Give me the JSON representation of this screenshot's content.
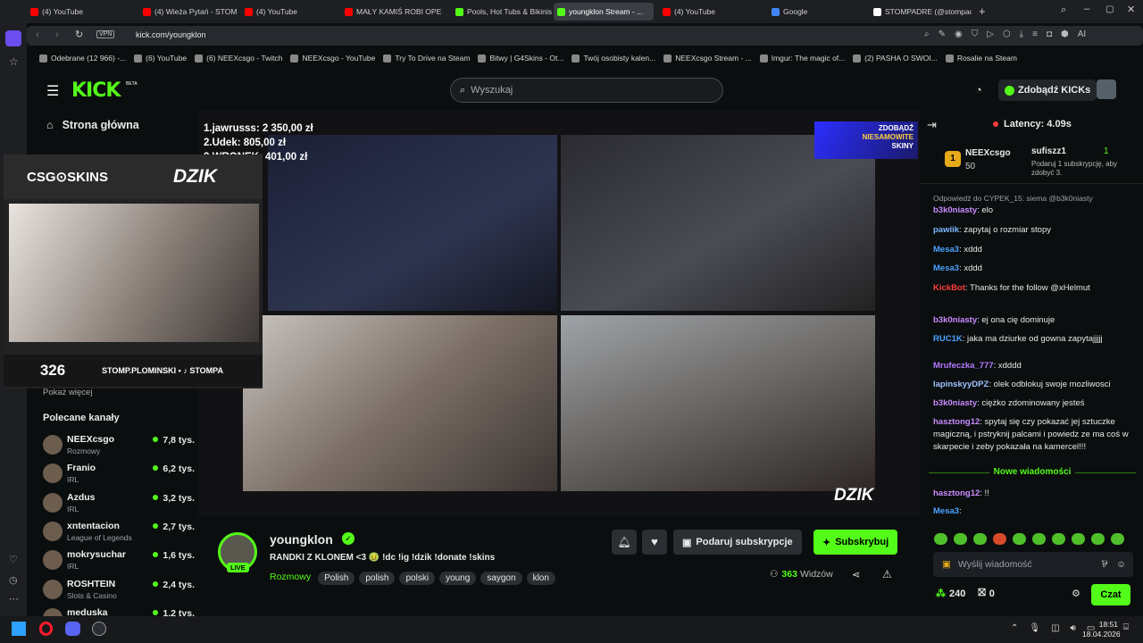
{
  "browser": {
    "tabs": [
      {
        "label": "(4) YouTube",
        "color": "#ff0000"
      },
      {
        "label": "(4) Wieża Pytań - STOMP",
        "color": "#ff0000"
      },
      {
        "label": "(4) YouTube",
        "color": "#ff0000"
      },
      {
        "label": "MAŁY KAMIŚ ROBI OPEN...",
        "color": "#ff0000"
      },
      {
        "label": "Pools, Hot Tubs & Bikinis",
        "color": "#53fc18"
      },
      {
        "label": "youngklon Stream - ...",
        "color": "#53fc18"
      },
      {
        "label": "(4) YouTube",
        "color": "#ff0000"
      },
      {
        "label": "Google",
        "color": "#4285f4"
      },
      {
        "label": "STOMPADRE (@stompadr...",
        "color": "#ffffff"
      }
    ],
    "vpn": "VPN",
    "url": "kick.com/youngklon",
    "bookmarks": [
      "Odebrane (12 966) -...",
      "(6) YouTube",
      "(6) NEEXcsgo - Twitch",
      "NEEXcsgo - YouTube",
      "Try To Drive na Steam",
      "Bitwy | G4Skins - Ot...",
      "Twój osobisty kalen...",
      "NEEXcsgo Stream - ...",
      "Imgur: The magic of...",
      "(2) PASHA O SWOI...",
      "Rosalie na Steam"
    ],
    "ai_label": "AI"
  },
  "kick": {
    "logo": "KICK",
    "beta": "BETA",
    "search_placeholder": "Wyszukaj",
    "get_kicks": "Zdobądź KICKs"
  },
  "sidebar": {
    "home": "Strona główna",
    "show_more": "Pokaż więcej",
    "recommended_title": "Polecane kanały",
    "channels": [
      {
        "name": "NEEXcsgo",
        "cat": "Rozmowy",
        "views": "7,8 tys."
      },
      {
        "name": "Franio",
        "cat": "IRL",
        "views": "6,2 tys."
      },
      {
        "name": "Azdus",
        "cat": "IRL",
        "views": "3,2 tys."
      },
      {
        "name": "xntentacion",
        "cat": "League of Legends",
        "views": "2,7 tys."
      },
      {
        "name": "mokrysuchar",
        "cat": "IRL",
        "views": "1,6 tys."
      },
      {
        "name": "ROSHTEIN",
        "cat": "Slots & Casino",
        "views": "2,4 tys."
      },
      {
        "name": "meduska",
        "cat": "",
        "views": "1,2 tys."
      }
    ]
  },
  "overlay": {
    "donors": [
      "1.jawrusss: 2 350,00 zł",
      "2.Udek: 805,00 zł",
      "3.WRONEK: 401,00 zł"
    ],
    "brand1": "CSG⊙SKINS",
    "brand2": "DZIK",
    "counter": "326",
    "handle": "STOMP.PLOMINSKI • ♪ STOMPA",
    "promo1": "ZDOBĄDŹ",
    "promo2": "NIESAMOWITE",
    "promo3": "SKINY",
    "promo_brand": "CSG⊙SKINS",
    "dzik_logo": "DZIK"
  },
  "stream": {
    "channel": "youngklon",
    "live": "LIVE",
    "title": "RANDKI Z KLONEM <3 🤢 !dc !ig !dzik !donate !skins",
    "category": "Rozmowy",
    "tags": [
      "Polish",
      "polish",
      "polski",
      "young",
      "saygon",
      "klon"
    ],
    "viewers": "363",
    "viewers_label": "Widzów",
    "gift_sub": "Podaruj subskrypcje",
    "subscribe": "Subskrybuj"
  },
  "chat": {
    "latency": "Latency: 4.09s",
    "top_gifter": {
      "rank": "1",
      "name": "NEEXcsgo",
      "amount": "50"
    },
    "gift_goal": {
      "name": "sufiszz1",
      "count": "1",
      "text": "Podaruj 1 subskrypcję, aby zdobyć 3."
    },
    "reply_to": "Odpowiedź do CYPEK_15: siema @b3k0niasty",
    "messages": [
      {
        "user": "b3k0niasty",
        "color": "#c98bff",
        "text": ": elo"
      },
      {
        "user": "pawiik",
        "color": "#7ab8ff",
        "text": ": zapytaj o rozmiar stopy"
      },
      {
        "user": "Mesa3",
        "color": "#4aa3ff",
        "text": ": xddd"
      },
      {
        "user": "Mesa3",
        "color": "#4aa3ff",
        "text": ": xddd"
      },
      {
        "user": "KickBot",
        "color": "#ff3b3b",
        "text": ": Thanks for the follow @xHelmut"
      },
      {
        "user": "b3k0niasty",
        "color": "#c98bff",
        "text": ": ej ona cię dominuje"
      },
      {
        "user": "RUC1K",
        "color": "#4aa3ff",
        "text": ": jaka ma dziurke od gowna zapytajjjjj"
      },
      {
        "user": "Mrufeczka_777",
        "color": "#b37bff",
        "text": ": xdddd"
      },
      {
        "user": "lapinskyyDPZ",
        "color": "#9fc2ff",
        "text": ": olek odblokuj swoje mozliwosci"
      },
      {
        "user": "b3k0niasty",
        "color": "#c98bff",
        "text": ": ciężko zdominowany jesteś"
      },
      {
        "user": "hasztong12",
        "color": "#c98bff",
        "text": ": spytaj się czy pokazać jej sztuczke magiczną, i pstryknij palcami i powiedz ze ma coś w skarpecie i zeby pokazała na kamercel!!!"
      },
      {
        "user": "hasztong12",
        "color": "#c98bff",
        "text": ": !!"
      },
      {
        "user": "Mesa3",
        "color": "#4aa3ff",
        "text": ":"
      }
    ],
    "new_messages": "Nowe wiadomości",
    "input_placeholder": "Wyślij wiadomość",
    "points": "240",
    "points2": "0",
    "send": "Czat"
  },
  "taskbar": {
    "time": "18:51",
    "date": "18.04.2026"
  }
}
